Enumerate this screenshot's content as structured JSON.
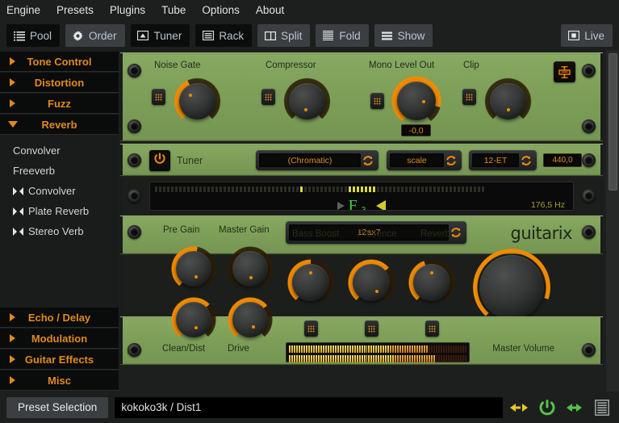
{
  "menubar": {
    "items": [
      {
        "label": "Engine"
      },
      {
        "label": "Presets"
      },
      {
        "label": "Plugins"
      },
      {
        "label": "Tube"
      },
      {
        "label": "Options"
      },
      {
        "label": "About"
      }
    ]
  },
  "toolbar": {
    "buttons": [
      {
        "label": "Pool",
        "icon": "list-icon",
        "state": "dark"
      },
      {
        "label": "Order",
        "icon": "gear-icon",
        "state": "raised"
      },
      {
        "label": "Tuner",
        "icon": "tuner-icon",
        "state": "dark"
      },
      {
        "label": "Rack",
        "icon": "rack-icon",
        "state": "dark"
      },
      {
        "label": "Split",
        "icon": "split-icon",
        "state": "raised"
      },
      {
        "label": "Fold",
        "icon": "fold-icon",
        "state": "raised"
      },
      {
        "label": "Show",
        "icon": "show-icon",
        "state": "raised"
      }
    ],
    "live": {
      "label": "Live",
      "icon": "fullscreen-icon"
    }
  },
  "sidebar": {
    "categories": [
      {
        "label": "Tone Control",
        "open": false
      },
      {
        "label": "Distortion",
        "open": false
      },
      {
        "label": "Fuzz",
        "open": false
      },
      {
        "label": "Reverb",
        "open": true
      }
    ],
    "plugins": [
      {
        "label": "Convolver",
        "stereo": false
      },
      {
        "label": "Freeverb",
        "stereo": false
      },
      {
        "label": "Convolver",
        "stereo": true
      },
      {
        "label": "Plate Reverb",
        "stereo": true
      },
      {
        "label": "Stereo Verb",
        "stereo": true
      }
    ],
    "categories_bottom": [
      {
        "label": "Echo / Delay",
        "open": false
      },
      {
        "label": "Modulation",
        "open": false
      },
      {
        "label": "Guitar Effects",
        "open": false
      },
      {
        "label": "Misc",
        "open": false
      }
    ]
  },
  "rack": {
    "master_unit": {
      "controls": [
        {
          "label": "Noise Gate",
          "value_angle": -140
        },
        {
          "label": "Compressor",
          "value_angle": 30
        },
        {
          "label": "Mono Level Out",
          "value_angle": 55,
          "readout": "-0,0"
        },
        {
          "label": "Clip",
          "value_angle": 35
        }
      ],
      "link_icon": "io-link-icon"
    },
    "tuner_unit": {
      "title": "Tuner",
      "power_icon": "power-icon",
      "selectors": [
        {
          "value": "(Chromatic)",
          "refresh_icon": "refresh-icon"
        },
        {
          "value": "scale",
          "refresh_icon": "refresh-icon"
        },
        {
          "value": "12-ET",
          "refresh_icon": "refresh-icon"
        }
      ],
      "reference": "440,0",
      "display": {
        "note": "F",
        "octave": "3",
        "frequency": "176,5 Hz"
      }
    },
    "amp_unit": {
      "brand": "guitarix",
      "tube_selector": {
        "value": "12ax7",
        "refresh_icon": "refresh-icon"
      },
      "top_knobs": [
        {
          "label": "Pre Gain"
        },
        {
          "label": "Master Gain"
        }
      ],
      "mid_knobs": [
        {
          "label": "Bass Boost"
        },
        {
          "label": "Presence"
        },
        {
          "label": "Reverb"
        }
      ],
      "bottom_knobs": [
        {
          "label": "Clean/Dist"
        },
        {
          "label": "Drive"
        }
      ],
      "master_volume_label": "Master Volume"
    }
  },
  "bottombar": {
    "preset_button": "Preset Selection",
    "preset_value": "kokoko3k / Dist1",
    "icons": [
      {
        "name": "prev-next-icon",
        "color": "#e8c62a"
      },
      {
        "name": "power-icon",
        "color": "#56c245"
      },
      {
        "name": "bypass-icon",
        "color": "#56c245"
      },
      {
        "name": "list-icon",
        "color": "#aab0b0"
      }
    ]
  },
  "colors": {
    "accent_orange": "#e08a1e",
    "panel_green": "#7d9f58",
    "bg_dark": "#1d1f1e",
    "note_green": "#36d23b",
    "tuner_yellow": "#d8c92a"
  }
}
